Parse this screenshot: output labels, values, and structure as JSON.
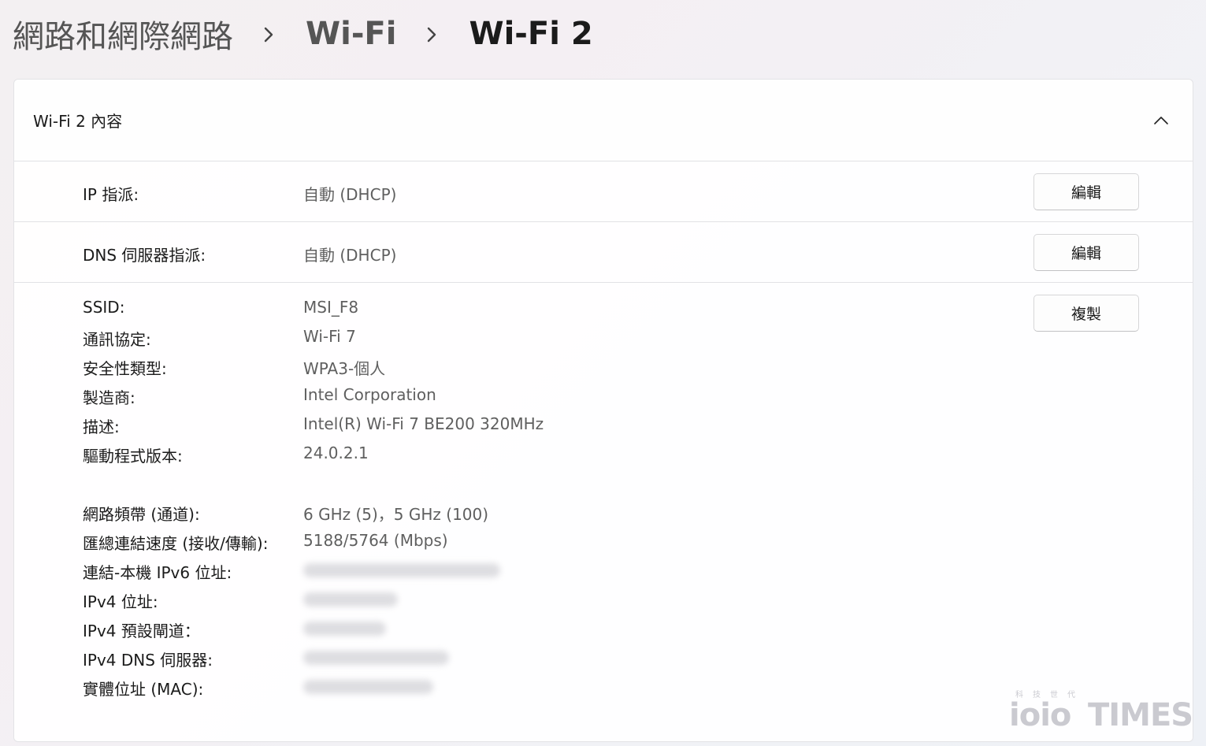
{
  "breadcrumb": {
    "items": [
      "網路和網際網路",
      "Wi-Fi"
    ],
    "current": "Wi-Fi 2"
  },
  "card": {
    "title": "Wi-Fi 2 內容"
  },
  "ip_row": {
    "label": "IP 指派:",
    "value": "自動 (DHCP)",
    "button": "編輯"
  },
  "dns_row": {
    "label": "DNS 伺服器指派:",
    "value": "自動 (DHCP)",
    "button": "編輯"
  },
  "details": {
    "copy_button": "複製",
    "ssid_label": "SSID:",
    "ssid_value": "MSI_F8",
    "protocol_label": "通訊協定:",
    "protocol_value": "Wi-Fi 7",
    "security_label": "安全性類型:",
    "security_value": "WPA3-個人",
    "manufacturer_label": "製造商:",
    "manufacturer_value": "Intel Corporation",
    "description_label": "描述:",
    "description_value": "Intel(R) Wi-Fi 7 BE200 320MHz",
    "driver_label": "驅動程式版本:",
    "driver_value": "24.0.2.1",
    "band_label": "網路頻帶 (通道):",
    "band_value": "6 GHz (5)，5 GHz (100)",
    "speed_label": "匯總連結速度 (接收/傳輸):",
    "speed_value": "5188/5764 (Mbps)",
    "ipv6_label": "連結-本機 IPv6 位址:",
    "ipv4_label": "IPv4 位址:",
    "gateway_label": "IPv4 預設閘道：",
    "dns_label": "IPv4 DNS 伺服器:",
    "mac_label": "實體位址 (MAC):"
  },
  "watermark": {
    "logo": "ioio",
    "times": "TIMES",
    "top": "科技世代"
  },
  "icons": {
    "breadcrumb_separator": "chevron-right-icon",
    "collapse": "chevron-up-icon"
  }
}
